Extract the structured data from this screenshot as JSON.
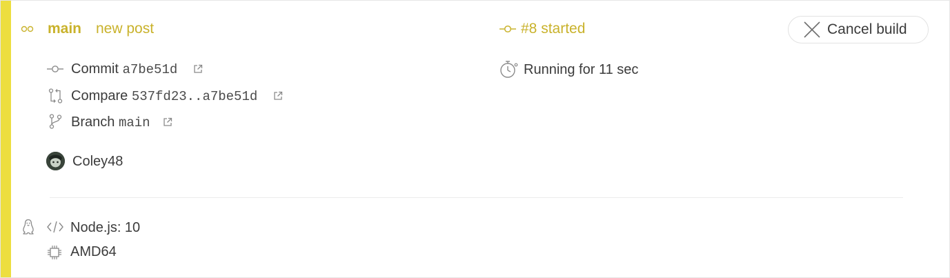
{
  "build": {
    "branch": "main",
    "commit_message": "new post",
    "state": "#8 started",
    "duration": "Running for 11 sec",
    "cancel_label": "Cancel build"
  },
  "details": {
    "commit_label": "Commit",
    "commit_sha": "a7be51d",
    "compare_label": "Compare",
    "compare_range": "537fd23..a7be51d",
    "branch_label": "Branch",
    "branch_name": "main",
    "author": "Coley48"
  },
  "job": {
    "language": "Node.js: 10",
    "arch": "AMD64"
  },
  "colors": {
    "accent": "#edde3f",
    "accent_text": "#c9b22b",
    "text": "#3b3b3b",
    "icon": "#8a8a8a"
  },
  "icons": {
    "branch_status": "double-circle-icon",
    "commit": "commit-icon",
    "compare": "compare-icon",
    "branch": "branch-icon",
    "external": "external-link-icon",
    "stopwatch": "stopwatch-icon",
    "close": "close-icon",
    "os": "linux-icon",
    "code": "code-icon",
    "cpu": "cpu-icon"
  }
}
